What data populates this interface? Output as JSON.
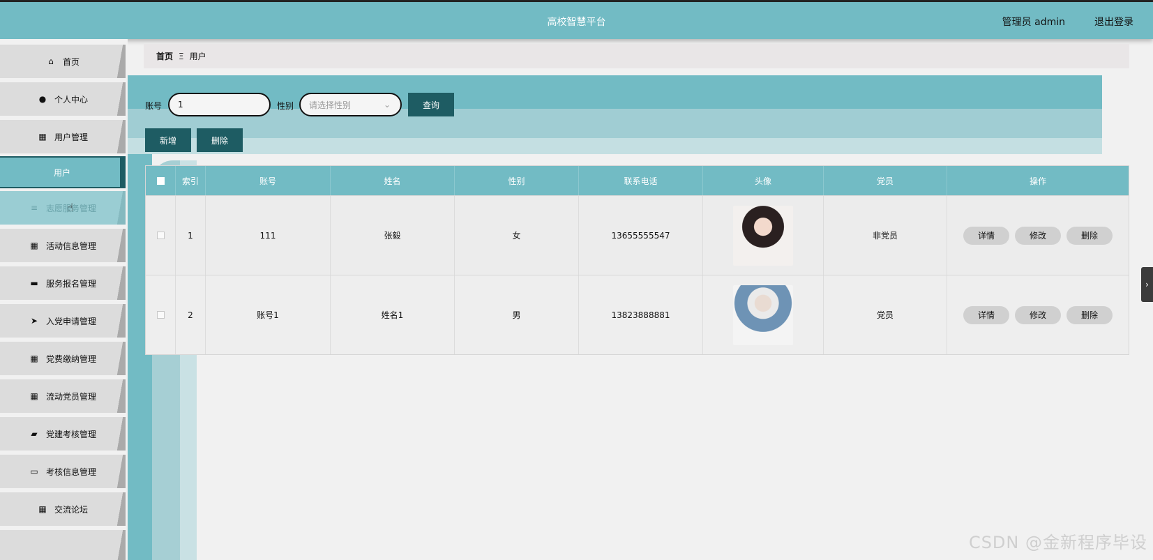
{
  "header": {
    "title": "高校智慧平台",
    "user": "管理员 admin",
    "logout": "退出登录"
  },
  "sidebar": {
    "items": [
      {
        "label": "首页",
        "icon": "home-icon",
        "glyph": "⌂"
      },
      {
        "label": "个人中心",
        "icon": "person-icon",
        "glyph": "●"
      },
      {
        "label": "用户管理",
        "icon": "grid-icon",
        "glyph": "▦"
      },
      {
        "label": "用户",
        "icon": "",
        "glyph": ""
      },
      {
        "label": "志愿服务管理",
        "icon": "list-icon",
        "glyph": "≡"
      },
      {
        "label": "活动信息管理",
        "icon": "grid-icon",
        "glyph": "▦"
      },
      {
        "label": "服务报名管理",
        "icon": "comment-icon",
        "glyph": "▬"
      },
      {
        "label": "入党申请管理",
        "icon": "send-icon",
        "glyph": "➤"
      },
      {
        "label": "党费缴纳管理",
        "icon": "grid-icon",
        "glyph": "▦"
      },
      {
        "label": "流动党员管理",
        "icon": "grid-icon",
        "glyph": "▦"
      },
      {
        "label": "党建考核管理",
        "icon": "ticket-icon",
        "glyph": "▰"
      },
      {
        "label": "考核信息管理",
        "icon": "monitor-icon",
        "glyph": "▭"
      },
      {
        "label": "交流论坛",
        "icon": "grid-icon",
        "glyph": "▦"
      }
    ]
  },
  "breadcrumb": {
    "home": "首页",
    "separator": "Ξ",
    "current": "用户"
  },
  "search": {
    "account_label": "账号",
    "account_value": "1",
    "gender_label": "性别",
    "gender_placeholder": "请选择性别",
    "query_button": "查询",
    "add_button": "新增",
    "delete_button": "删除"
  },
  "table": {
    "headers": [
      "索引",
      "账号",
      "姓名",
      "性别",
      "联系电话",
      "头像",
      "党员",
      "操作"
    ],
    "rows": [
      {
        "index": "1",
        "account": "111",
        "name": "张毅",
        "gender": "女",
        "phone": "13655555547",
        "party": "非党员"
      },
      {
        "index": "2",
        "account": "账号1",
        "name": "姓名1",
        "gender": "男",
        "phone": "13823888881",
        "party": "党员"
      }
    ],
    "actions": {
      "detail": "详情",
      "edit": "修改",
      "delete": "删除"
    }
  },
  "watermark": "CSDN @金新程序毕设",
  "colors": {
    "teal": "#72bbc4",
    "dark_teal": "#1e5c63"
  }
}
